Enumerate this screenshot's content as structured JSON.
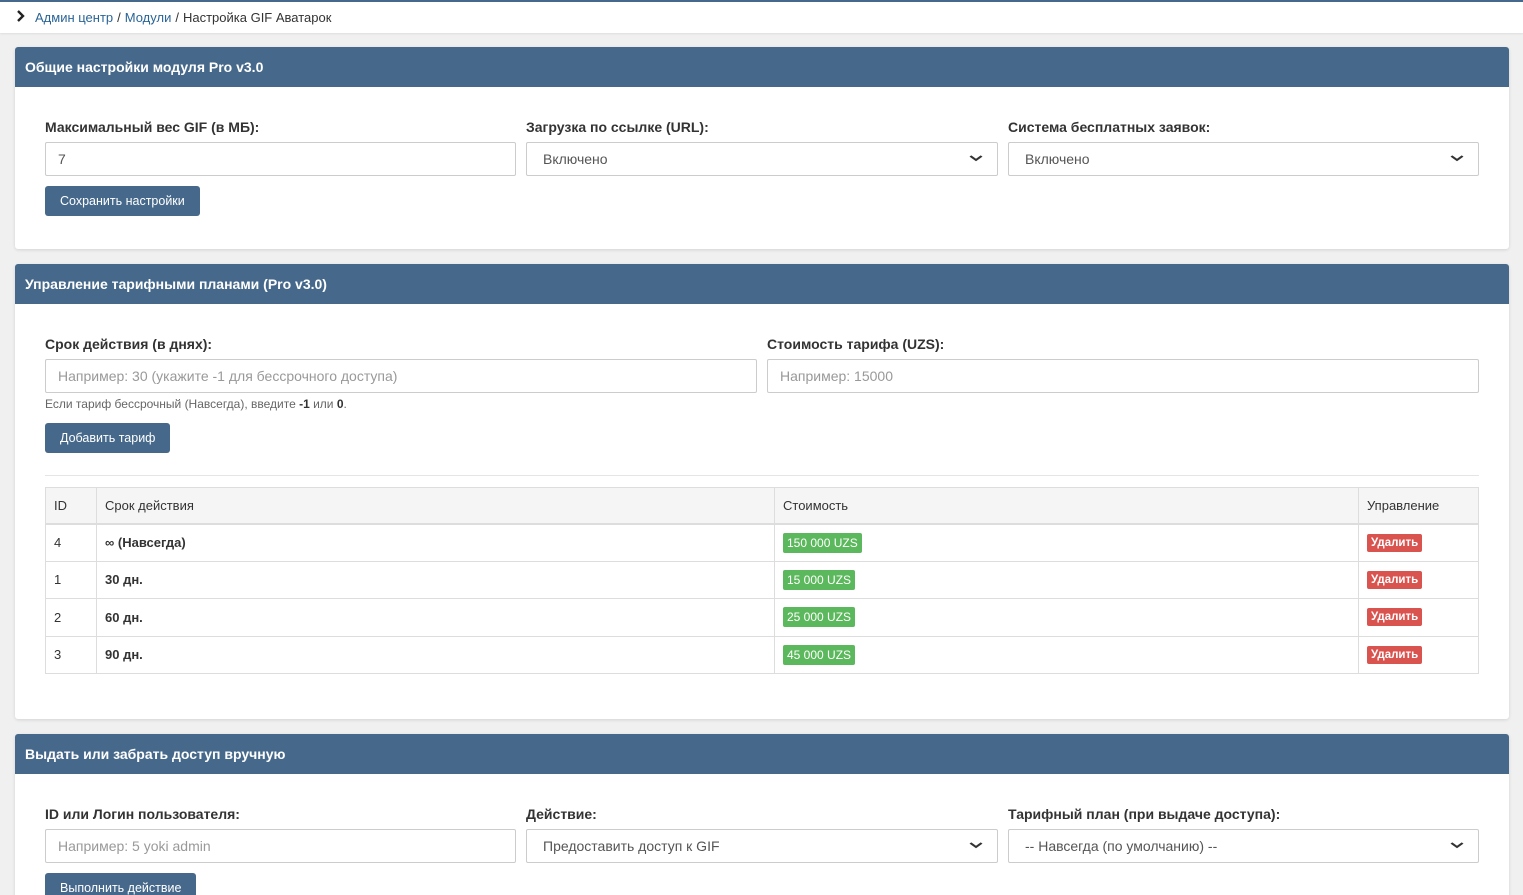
{
  "breadcrumb": {
    "items": [
      "Админ центр",
      "Модули"
    ],
    "current": "Настройка GIF Аватарок",
    "separator": "/"
  },
  "general": {
    "title": "Общие настройки модуля Pro v3.0",
    "max_size_label": "Максимальный вес GIF (в МБ):",
    "max_size_value": "7",
    "url_upload_label": "Загрузка по ссылке (URL):",
    "url_upload_value": "Включено",
    "free_requests_label": "Система бесплатных заявок:",
    "free_requests_value": "Включено",
    "save_button": "Сохранить настройки"
  },
  "plans": {
    "title": "Управление тарифными планами (Pro v3.0)",
    "duration_label": "Срок действия (в днях):",
    "duration_placeholder": "Например: 30 (укажите -1 для бессрочного доступа)",
    "price_label": "Стоимость тарифа (UZS):",
    "price_placeholder": "Например: 15000",
    "hint_text": "Если тариф бессрочный (Навсегда), введите ",
    "hint_val1": "-1",
    "hint_or": " или ",
    "hint_val2": "0",
    "hint_end": ".",
    "add_button": "Добавить тариф",
    "table": {
      "headers": [
        "ID",
        "Срок действия",
        "Стоимость",
        "Управление"
      ],
      "rows": [
        {
          "id": "4",
          "term": "∞ (Навсегда)",
          "price": "150 000 UZS",
          "action": "Удалить"
        },
        {
          "id": "1",
          "term": "30 дн.",
          "price": "15 000 UZS",
          "action": "Удалить"
        },
        {
          "id": "2",
          "term": "60 дн.",
          "price": "25 000 UZS",
          "action": "Удалить"
        },
        {
          "id": "3",
          "term": "90 дн.",
          "price": "45 000 UZS",
          "action": "Удалить"
        }
      ]
    }
  },
  "access": {
    "title": "Выдать или забрать доступ вручную",
    "user_label": "ID или Логин пользователя:",
    "user_placeholder": "Например: 5 yoki admin",
    "action_label": "Действие:",
    "action_value": "Предоставить доступ к GIF",
    "plan_label": "Тарифный план (при выдаче доступа):",
    "plan_value": "-- Навсегда (по умолчанию) --",
    "run_button": "Выполнить действие"
  },
  "colors": {
    "header_bg": "#46698b",
    "price_badge": "#5cb85c",
    "delete_badge": "#d9534f",
    "link": "#2a6496"
  }
}
